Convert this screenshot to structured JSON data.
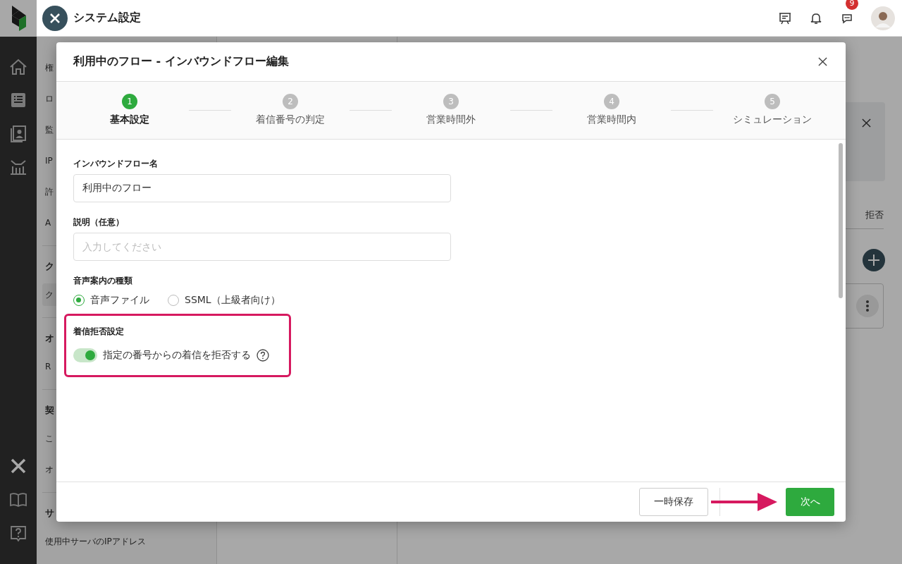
{
  "app": {
    "section_title": "システム設定",
    "notification_count": "9"
  },
  "sidebar": {
    "groups": [
      {
        "items": [
          {
            "label": "権",
            "selected": false
          },
          {
            "label": "ロ",
            "selected": false
          },
          {
            "label": "監",
            "selected": false
          },
          {
            "label": "IP",
            "selected": false
          },
          {
            "label": "許",
            "selected": false
          },
          {
            "label": "A",
            "selected": false
          }
        ]
      },
      {
        "heading": "ク",
        "items": [
          {
            "label": "ク",
            "selected": true
          }
        ]
      },
      {
        "heading": "オ",
        "items": [
          {
            "label": "R",
            "selected": false
          }
        ]
      },
      {
        "heading": "契",
        "items": [
          {
            "label": "こ",
            "selected": false
          },
          {
            "label": "オ",
            "selected": false
          }
        ]
      },
      {
        "heading": "サ",
        "items": [
          {
            "label": "使用中サーバのIPアドレス",
            "selected": false
          }
        ]
      }
    ]
  },
  "main": {
    "tab_fragment": "拒否"
  },
  "modal": {
    "title": "利用中のフロー - インバウンドフロー編集",
    "steps": [
      {
        "number": "1",
        "label": "基本設定",
        "selected": true
      },
      {
        "number": "2",
        "label": "着信番号の判定",
        "selected": false
      },
      {
        "number": "3",
        "label": "営業時間外",
        "selected": false
      },
      {
        "number": "4",
        "label": "営業時間内",
        "selected": false
      },
      {
        "number": "5",
        "label": "シミュレーション",
        "selected": false
      }
    ],
    "fields": [
      {
        "label": "インバウンドフロー名",
        "value": "利用中のフロー"
      },
      {
        "label": "説明（任意）",
        "placeholder": "入力してください"
      }
    ],
    "voice_type": {
      "label": "音声案内の種類",
      "options": [
        {
          "label": "音声ファイル",
          "selected": true
        },
        {
          "label": "SSML（上級者向け）",
          "selected": false
        }
      ]
    },
    "reject": {
      "label": "着信拒否設定",
      "toggle_label": "指定の番号からの着信を拒否する",
      "on": true,
      "highlighted": true
    },
    "buttons": [
      {
        "label": "一時保存",
        "kind": "secondary"
      },
      {
        "label": "次へ",
        "kind": "primary"
      }
    ]
  }
}
